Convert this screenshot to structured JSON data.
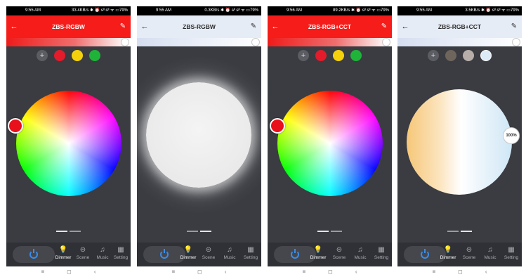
{
  "screens": [
    {
      "status": {
        "time": "9:55 AM",
        "info": "33.4KB/s ✱ ⏰ ᵴᴵᴵ ᵴᴵᴵ ᯤ ▭79%"
      },
      "title": "ZBS-RGBW",
      "swatches": [
        "#e31b2a",
        "#f5d10c",
        "#1fb33a"
      ],
      "tabs": {
        "dimmer": "Dimmer",
        "scene": "Scene",
        "music": "Music",
        "setting": "Setting"
      }
    },
    {
      "status": {
        "time": "9:55 AM",
        "info": "0.3KB/s ✱ ⏰ ᵴᴵᴵ ᵴᴵᴵ ᯤ ▭79%"
      },
      "title": "ZBS-RGBW",
      "tabs": {
        "dimmer": "Dimmer",
        "scene": "Scene",
        "music": "Music",
        "setting": "Setting"
      }
    },
    {
      "status": {
        "time": "9:56 AM",
        "info": "89.2KB/s ✱ ⏰ ᵴᴵᴵ ᵴᴵᴵ ᯤ ▭79%"
      },
      "title": "ZBS-RGB+CCT",
      "swatches": [
        "#e31b2a",
        "#f5d10c",
        "#1fb33a"
      ],
      "tabs": {
        "dimmer": "Dimmer",
        "scene": "Scene",
        "music": "Music",
        "setting": "Setting"
      }
    },
    {
      "status": {
        "time": "9:55 AM",
        "info": "3.5KB/s ✱ ⏰ ᵴᴵᴵ ᵴᴵᴵ ᯤ ▭79%"
      },
      "title": "ZBS-RGB+CCT",
      "swatches": [
        "#6e655c",
        "#b7aeaa",
        "#ddeaf7"
      ],
      "brightness_percent": "100%",
      "tabs": {
        "dimmer": "Dimmer",
        "scene": "Scene",
        "music": "Music",
        "setting": "Setting"
      }
    }
  ],
  "icons": {
    "back": "←",
    "edit": "✎",
    "add": "+",
    "dimmer": "💡",
    "scene": "⊜",
    "music": "♫",
    "setting": "▦",
    "sys_menu": "≡",
    "sys_home": "◻",
    "sys_back": "‹"
  },
  "colors": {
    "accent_red": "#f51c19",
    "accent_light": "#e6ecf5",
    "power_blue": "#3c8ce6"
  }
}
